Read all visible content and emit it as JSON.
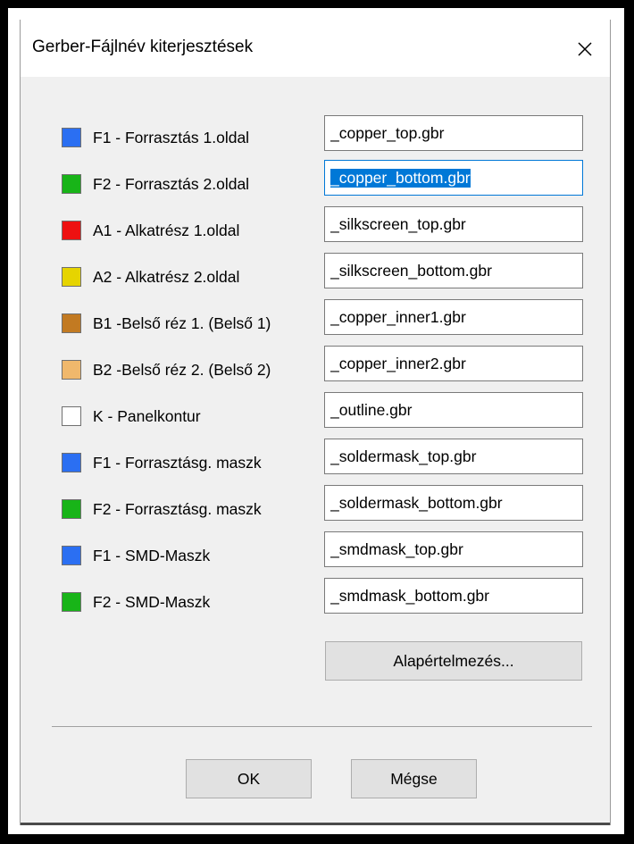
{
  "dialog": {
    "title": "Gerber-Fájlnév kiterjesztések",
    "close_label": "✕"
  },
  "layers": [
    {
      "label": "F1 - Forrasztás 1.oldal",
      "color": "#2b6ff2",
      "value": "_copper_top.gbr",
      "focused": false
    },
    {
      "label": "F2 - Forrasztás 2.oldal",
      "color": "#18b418",
      "value": "_copper_bottom.gbr",
      "focused": true
    },
    {
      "label": "A1 - Alkatrész 1.oldal",
      "color": "#ee1111",
      "value": "_silkscreen_top.gbr",
      "focused": false
    },
    {
      "label": "A2 - Alkatrész 2.oldal",
      "color": "#e6d400",
      "value": "_silkscreen_bottom.gbr",
      "focused": false
    },
    {
      "label": "B1 -Belső réz 1. (Belső 1)",
      "color": "#c27a22",
      "value": "_copper_inner1.gbr",
      "focused": false
    },
    {
      "label": "B2 -Belső réz 2. (Belső 2)",
      "color": "#f0b86c",
      "value": "_copper_inner2.gbr",
      "focused": false
    },
    {
      "label": "K - Panelkontur",
      "color": "#ffffff",
      "value": "_outline.gbr",
      "focused": false
    },
    {
      "label": "F1 - Forrasztásg. maszk",
      "color": "#2b6ff2",
      "value": "_soldermask_top.gbr",
      "focused": false
    },
    {
      "label": "F2 - Forrasztásg. maszk",
      "color": "#18b418",
      "value": "_soldermask_bottom.gbr",
      "focused": false
    },
    {
      "label": "F1 - SMD-Maszk",
      "color": "#2b6ff2",
      "value": "_smdmask_top.gbr",
      "focused": false
    },
    {
      "label": "F2 - SMD-Maszk",
      "color": "#18b418",
      "value": "_smdmask_bottom.gbr",
      "focused": false
    }
  ],
  "buttons": {
    "defaults": "Alapértelmezés...",
    "ok": "OK",
    "cancel": "Mégse"
  }
}
